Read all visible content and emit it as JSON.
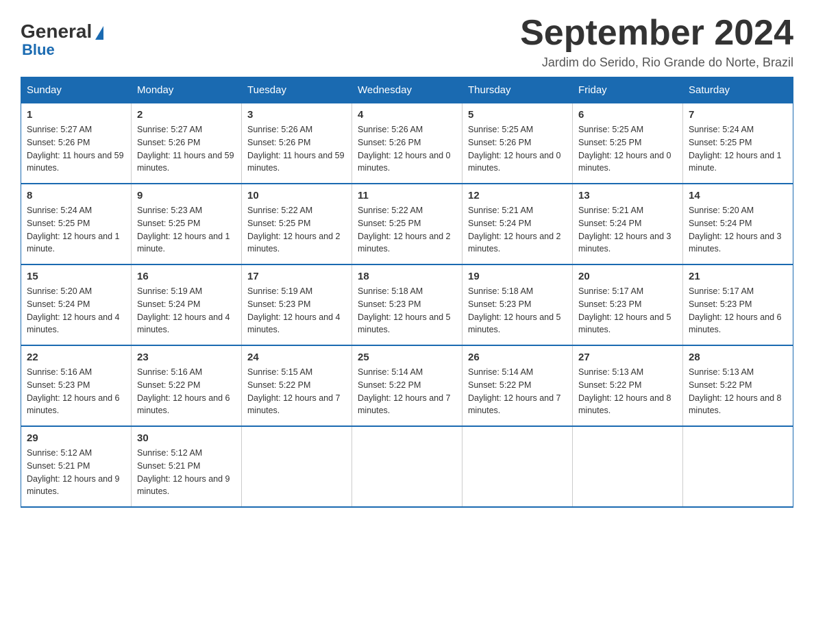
{
  "header": {
    "logo_general": "General",
    "logo_blue": "Blue",
    "month_title": "September 2024",
    "location": "Jardim do Serido, Rio Grande do Norte, Brazil"
  },
  "days_of_week": [
    "Sunday",
    "Monday",
    "Tuesday",
    "Wednesday",
    "Thursday",
    "Friday",
    "Saturday"
  ],
  "weeks": [
    [
      {
        "day": "1",
        "sunrise": "5:27 AM",
        "sunset": "5:26 PM",
        "daylight": "11 hours and 59 minutes."
      },
      {
        "day": "2",
        "sunrise": "5:27 AM",
        "sunset": "5:26 PM",
        "daylight": "11 hours and 59 minutes."
      },
      {
        "day": "3",
        "sunrise": "5:26 AM",
        "sunset": "5:26 PM",
        "daylight": "11 hours and 59 minutes."
      },
      {
        "day": "4",
        "sunrise": "5:26 AM",
        "sunset": "5:26 PM",
        "daylight": "12 hours and 0 minutes."
      },
      {
        "day": "5",
        "sunrise": "5:25 AM",
        "sunset": "5:26 PM",
        "daylight": "12 hours and 0 minutes."
      },
      {
        "day": "6",
        "sunrise": "5:25 AM",
        "sunset": "5:25 PM",
        "daylight": "12 hours and 0 minutes."
      },
      {
        "day": "7",
        "sunrise": "5:24 AM",
        "sunset": "5:25 PM",
        "daylight": "12 hours and 1 minute."
      }
    ],
    [
      {
        "day": "8",
        "sunrise": "5:24 AM",
        "sunset": "5:25 PM",
        "daylight": "12 hours and 1 minute."
      },
      {
        "day": "9",
        "sunrise": "5:23 AM",
        "sunset": "5:25 PM",
        "daylight": "12 hours and 1 minute."
      },
      {
        "day": "10",
        "sunrise": "5:22 AM",
        "sunset": "5:25 PM",
        "daylight": "12 hours and 2 minutes."
      },
      {
        "day": "11",
        "sunrise": "5:22 AM",
        "sunset": "5:25 PM",
        "daylight": "12 hours and 2 minutes."
      },
      {
        "day": "12",
        "sunrise": "5:21 AM",
        "sunset": "5:24 PM",
        "daylight": "12 hours and 2 minutes."
      },
      {
        "day": "13",
        "sunrise": "5:21 AM",
        "sunset": "5:24 PM",
        "daylight": "12 hours and 3 minutes."
      },
      {
        "day": "14",
        "sunrise": "5:20 AM",
        "sunset": "5:24 PM",
        "daylight": "12 hours and 3 minutes."
      }
    ],
    [
      {
        "day": "15",
        "sunrise": "5:20 AM",
        "sunset": "5:24 PM",
        "daylight": "12 hours and 4 minutes."
      },
      {
        "day": "16",
        "sunrise": "5:19 AM",
        "sunset": "5:24 PM",
        "daylight": "12 hours and 4 minutes."
      },
      {
        "day": "17",
        "sunrise": "5:19 AM",
        "sunset": "5:23 PM",
        "daylight": "12 hours and 4 minutes."
      },
      {
        "day": "18",
        "sunrise": "5:18 AM",
        "sunset": "5:23 PM",
        "daylight": "12 hours and 5 minutes."
      },
      {
        "day": "19",
        "sunrise": "5:18 AM",
        "sunset": "5:23 PM",
        "daylight": "12 hours and 5 minutes."
      },
      {
        "day": "20",
        "sunrise": "5:17 AM",
        "sunset": "5:23 PM",
        "daylight": "12 hours and 5 minutes."
      },
      {
        "day": "21",
        "sunrise": "5:17 AM",
        "sunset": "5:23 PM",
        "daylight": "12 hours and 6 minutes."
      }
    ],
    [
      {
        "day": "22",
        "sunrise": "5:16 AM",
        "sunset": "5:23 PM",
        "daylight": "12 hours and 6 minutes."
      },
      {
        "day": "23",
        "sunrise": "5:16 AM",
        "sunset": "5:22 PM",
        "daylight": "12 hours and 6 minutes."
      },
      {
        "day": "24",
        "sunrise": "5:15 AM",
        "sunset": "5:22 PM",
        "daylight": "12 hours and 7 minutes."
      },
      {
        "day": "25",
        "sunrise": "5:14 AM",
        "sunset": "5:22 PM",
        "daylight": "12 hours and 7 minutes."
      },
      {
        "day": "26",
        "sunrise": "5:14 AM",
        "sunset": "5:22 PM",
        "daylight": "12 hours and 7 minutes."
      },
      {
        "day": "27",
        "sunrise": "5:13 AM",
        "sunset": "5:22 PM",
        "daylight": "12 hours and 8 minutes."
      },
      {
        "day": "28",
        "sunrise": "5:13 AM",
        "sunset": "5:22 PM",
        "daylight": "12 hours and 8 minutes."
      }
    ],
    [
      {
        "day": "29",
        "sunrise": "5:12 AM",
        "sunset": "5:21 PM",
        "daylight": "12 hours and 9 minutes."
      },
      {
        "day": "30",
        "sunrise": "5:12 AM",
        "sunset": "5:21 PM",
        "daylight": "12 hours and 9 minutes."
      },
      null,
      null,
      null,
      null,
      null
    ]
  ]
}
